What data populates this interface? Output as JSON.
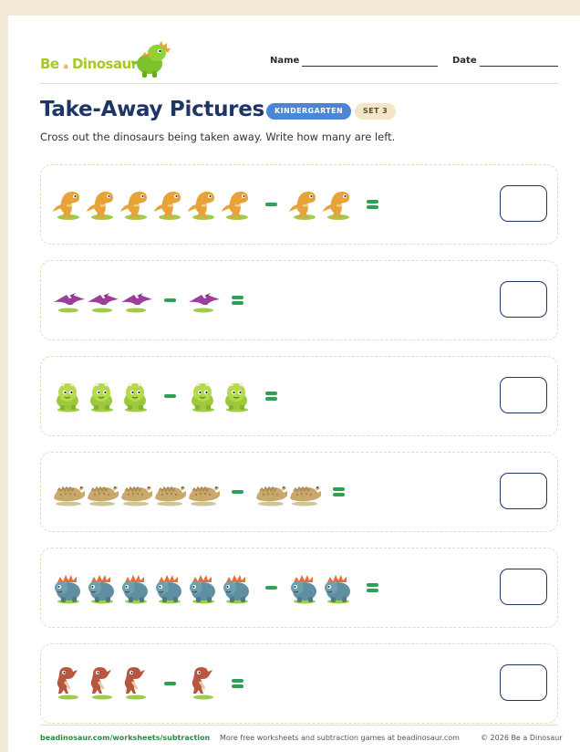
{
  "brand": {
    "name_main": "Be",
    "name_small": "a",
    "name_end": "Dinosaur"
  },
  "header": {
    "name_label": "Name",
    "date_label": "Date"
  },
  "title": "Take-Away Pictures",
  "badges": {
    "level": "KINDERGARTEN",
    "set": "SET 3"
  },
  "instructions": "Cross out the dinosaurs being taken away. Write how many are left.",
  "problems": [
    {
      "dino": "trex-dino-icon",
      "start": 6,
      "take": 2
    },
    {
      "dino": "pterodactyl-dino-icon",
      "start": 3,
      "take": 1
    },
    {
      "dino": "triceratops-dino-icon",
      "start": 3,
      "take": 2
    },
    {
      "dino": "ankylosaurus-dino-icon",
      "start": 5,
      "take": 2
    },
    {
      "dino": "stegosaurus-dino-icon",
      "start": 6,
      "take": 2
    },
    {
      "dino": "parasaur-dino-icon",
      "start": 3,
      "take": 1
    }
  ],
  "footer": {
    "left": "beadinosaur.com/worksheets/subtraction",
    "middle": "More free worksheets and subtraction games at beadinosaur.com",
    "right": "© 2026 Be a Dinosaur"
  },
  "colors": {
    "title": "#1f3566",
    "accent_green": "#2fa155",
    "badge_blue": "#4a86d4"
  }
}
